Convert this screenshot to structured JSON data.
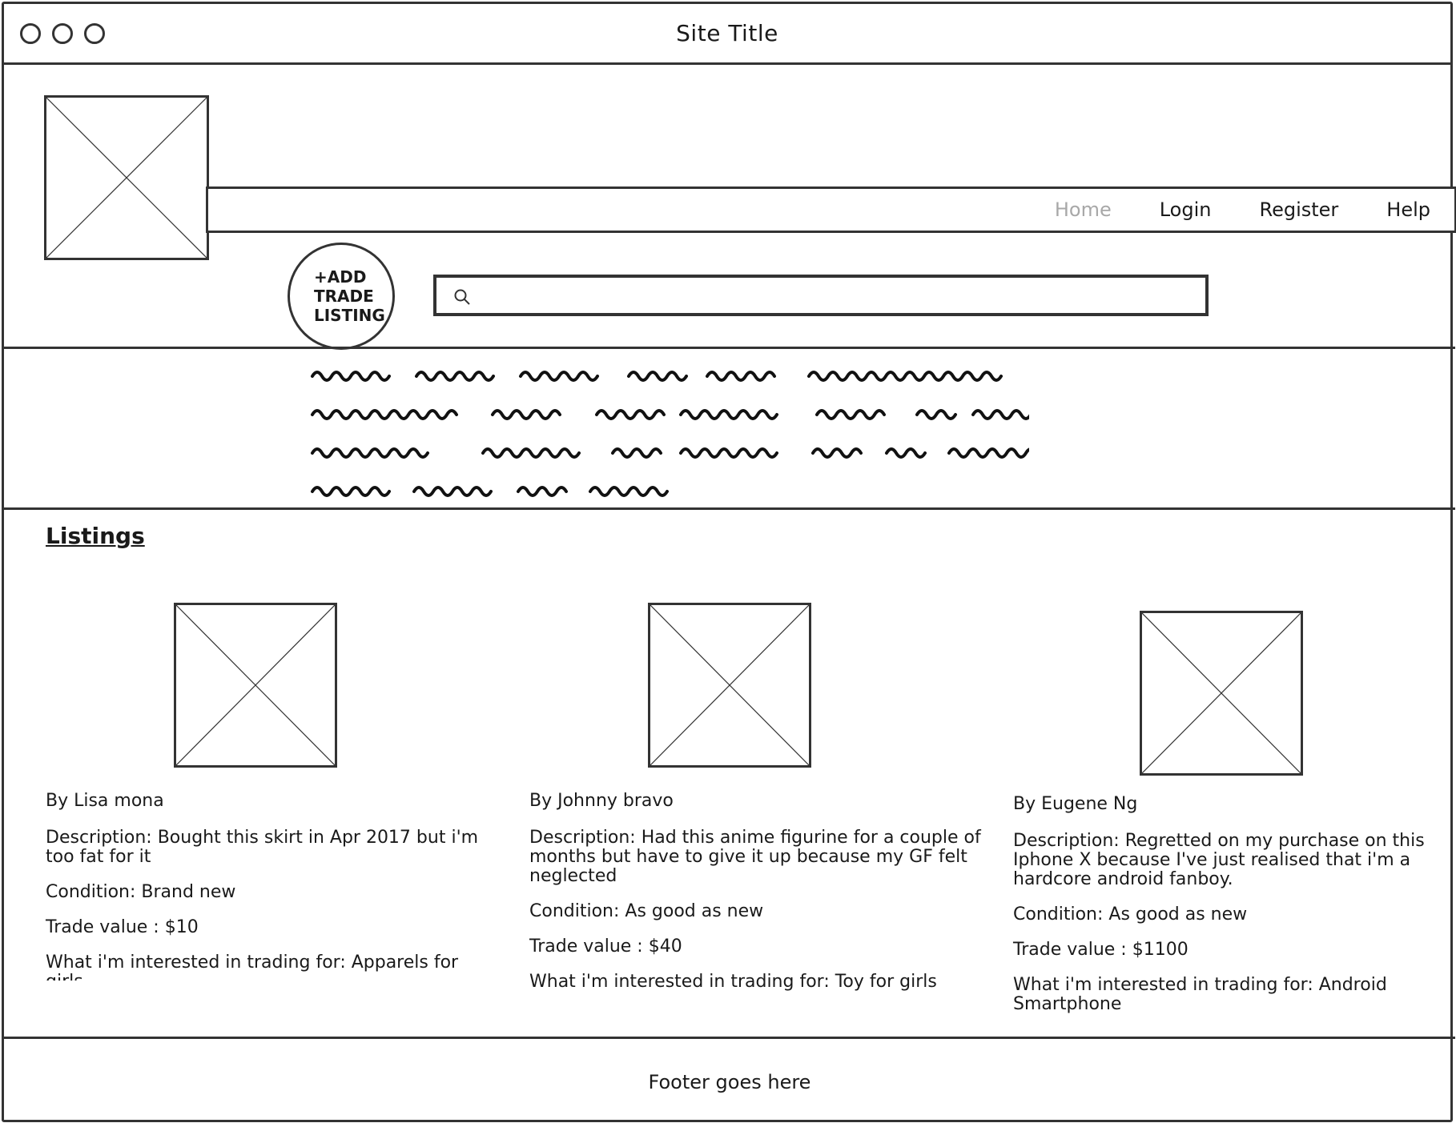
{
  "window": {
    "title": "Site Title"
  },
  "nav": {
    "items": [
      {
        "label": "Home",
        "active": true
      },
      {
        "label": "Login",
        "active": false
      },
      {
        "label": "Register",
        "active": false
      },
      {
        "label": "Help",
        "active": false
      }
    ]
  },
  "add_listing": {
    "line1": "+ADD",
    "line2": "TRADE",
    "line3": "LISTING"
  },
  "search": {
    "value": "",
    "placeholder": ""
  },
  "listings": {
    "heading": "Listings",
    "cards": [
      {
        "by": "By Lisa mona",
        "description": "Description: Bought this skirt in Apr 2017 but i'm too fat for it",
        "condition": "Condition: Brand new",
        "trade_value": "Trade value : $10",
        "interested": "What i'm interested in trading for: Apparels for girls"
      },
      {
        "by": "By Johnny bravo",
        "description": "Description: Had this anime figurine for a couple of months but have to give it up because my GF felt neglected",
        "condition": "Condition: As good as new",
        "trade_value": "Trade value : $40",
        "interested": "What i'm interested in trading for: Toy for girls"
      },
      {
        "by": "By Eugene Ng",
        "description": "Description: Regretted on my purchase on this Iphone X because I've just realised that i'm a hardcore android fanboy.",
        "condition": "Condition: As good as new",
        "trade_value": "Trade value : $1100",
        "interested": "What i'm interested in trading for: Android Smartphone"
      }
    ]
  },
  "footer": {
    "text": "Footer goes here"
  },
  "icons": {
    "search": "search-icon",
    "window_controls": "circle-icon",
    "image_placeholder": "image-placeholder-icon"
  },
  "colors": {
    "stroke": "#333333",
    "active_nav": "#a8a8a8"
  }
}
